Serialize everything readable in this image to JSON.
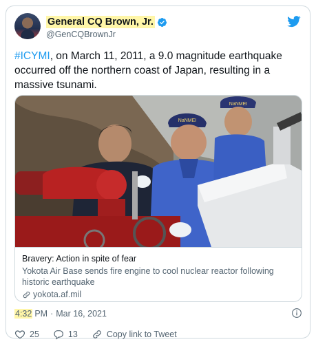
{
  "tweet": {
    "author": {
      "display_name": "General CQ Brown, Jr.",
      "handle": "@GenCQBrownJr",
      "avatar_icon": "avatar-photo",
      "verified_icon": "verified-badge-icon"
    },
    "brand_icon": "twitter-bird-icon",
    "hashtag": "#ICYMI",
    "body": ", on March 11, 2011, a 9.0 magnitude earthquake occurred off the northern coast of Japan, resulting in a massive tsunami.",
    "card": {
      "title": "Bravery: Action in spite of fear",
      "description": "Yokota Air Base sends fire engine to cool nuclear reactor following historic earthquake",
      "domain": "yokota.af.mil",
      "helmet_text_1": "NaNMEI",
      "helmet_text_2": "NaNMEI"
    },
    "time": "4:32",
    "time_suffix": "PM",
    "separator": "·",
    "date": "Mar 16, 2021",
    "actions": {
      "likes": "25",
      "replies": "13",
      "share_label": "Copy link to Tweet"
    }
  },
  "colors": {
    "accent": "#1d9bf0",
    "highlight": "#fff6a8",
    "muted": "#536471",
    "border": "#cfd9de"
  }
}
